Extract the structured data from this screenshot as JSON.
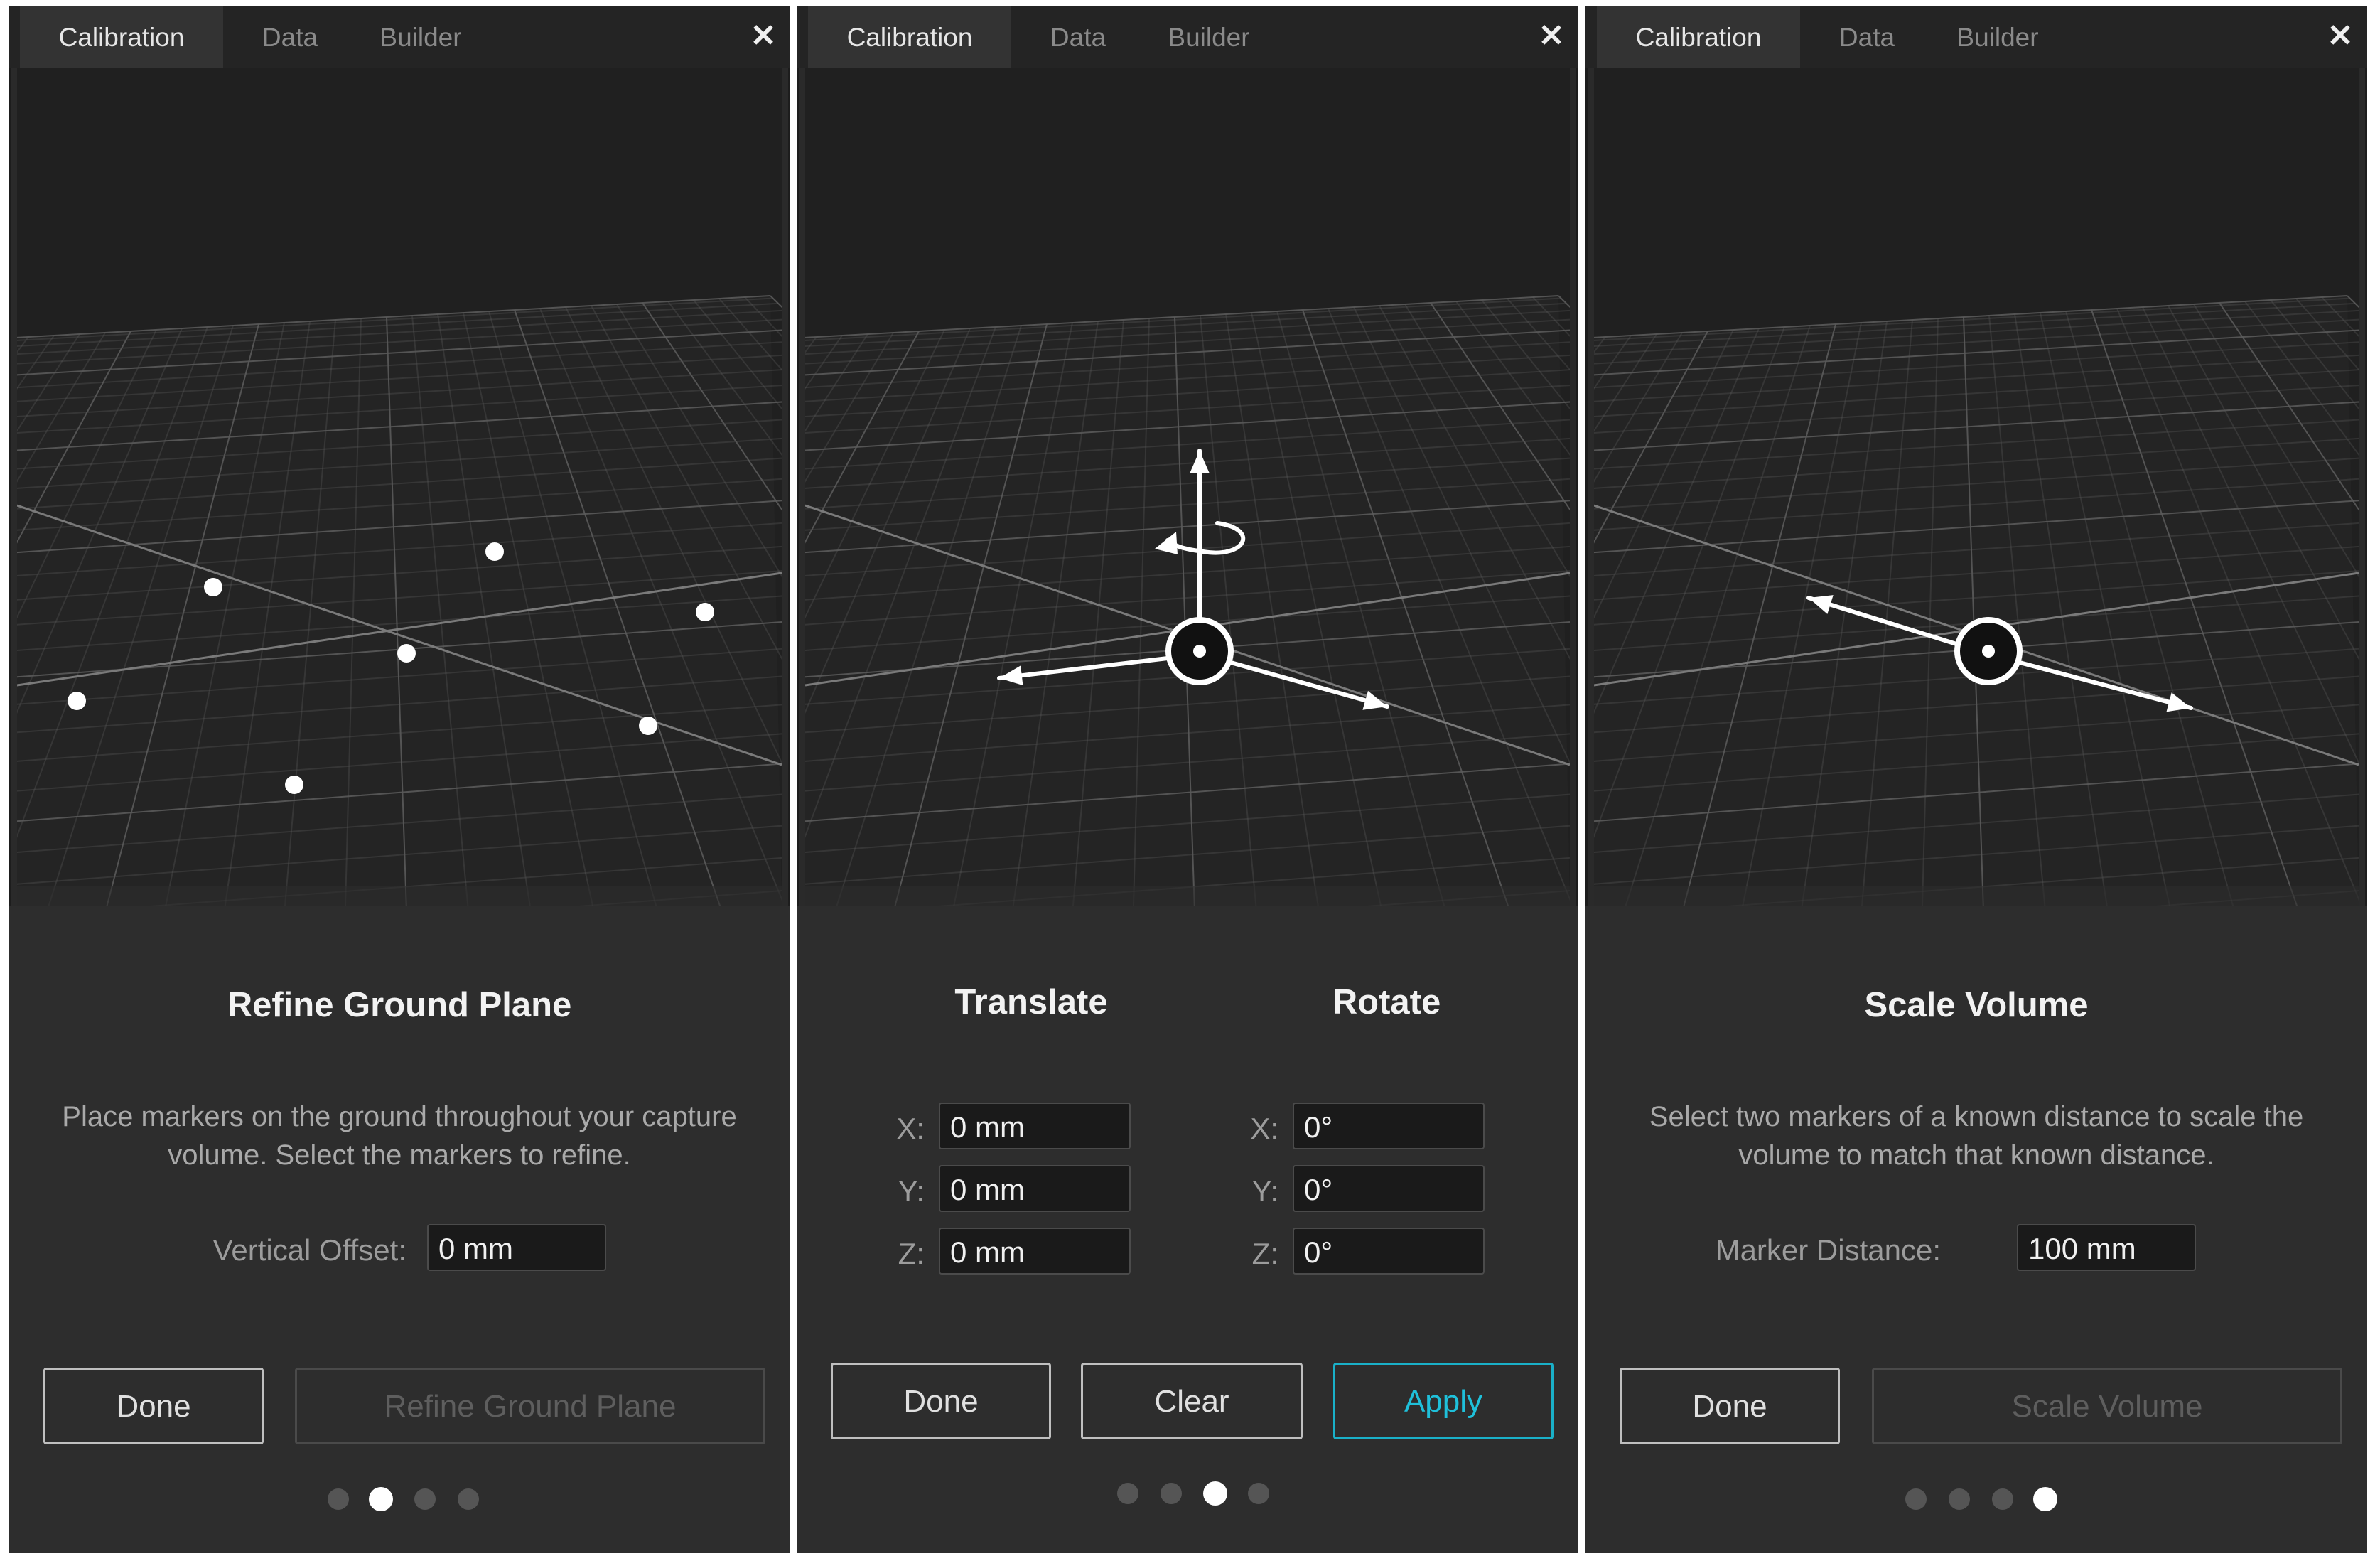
{
  "colors": {
    "panel_bg": "#2a2a2a",
    "viewport_bg": "#202020",
    "grid_line": "#5a5a5a",
    "accent": "#1fc0da",
    "marker": "#ffffff"
  },
  "tabs": [
    "Calibration",
    "Data",
    "Builder"
  ],
  "close_icon": "close-icon",
  "panels": [
    {
      "title": "Refine Ground Plane",
      "description": "Place markers on the ground throughout your capture volume. Select the markers to refine.",
      "field_label": "Vertical Offset:",
      "field_value": "0 mm",
      "done_label": "Done",
      "action_label": "Refine Ground Plane",
      "page_dots": 4,
      "active_dot": 2
    },
    {
      "translate_title": "Translate",
      "rotate_title": "Rotate",
      "translate": [
        {
          "axis": "X:",
          "value": "0 mm"
        },
        {
          "axis": "Y:",
          "value": "0 mm"
        },
        {
          "axis": "Z:",
          "value": "0 mm"
        }
      ],
      "rotate": [
        {
          "axis": "X:",
          "value": "0°"
        },
        {
          "axis": "Y:",
          "value": "0°"
        },
        {
          "axis": "Z:",
          "value": "0°"
        }
      ],
      "done_label": "Done",
      "clear_label": "Clear",
      "apply_label": "Apply",
      "page_dots": 4,
      "active_dot": 3
    },
    {
      "title": "Scale Volume",
      "description": "Select two markers of a known distance to scale the volume to match that known distance.",
      "field_label": "Marker Distance:",
      "field_value": "100 mm",
      "done_label": "Done",
      "action_label": "Scale Volume",
      "page_dots": 4,
      "active_dot": 4
    }
  ]
}
